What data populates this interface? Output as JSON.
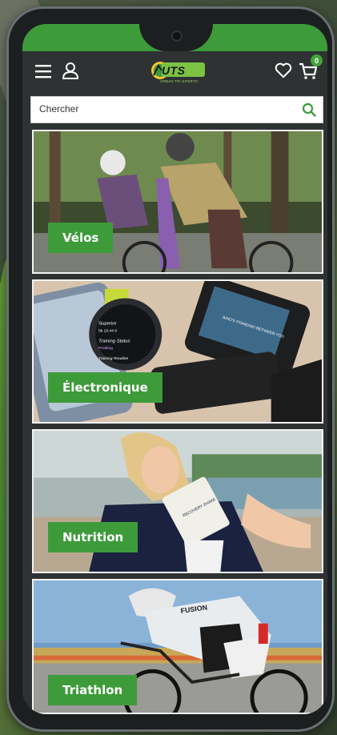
{
  "header": {
    "logo_text": "UTS",
    "logo_subtitle": "URBAN TRI SPORTS",
    "cart_count": "0"
  },
  "search": {
    "placeholder": "Chercher"
  },
  "categories": [
    {
      "label": "Vélos"
    },
    {
      "label": "Électronique"
    },
    {
      "label": "Nutrition"
    },
    {
      "label": "Triathlon"
    }
  ],
  "photo_text": {
    "watch_lines": [
      "Superior",
      "5k 15:44 0",
      "Training Status",
      "Peaking",
      "Training Readine"
    ],
    "gps_text": "WHO'S STANDING BETWEEN YOU",
    "pouch_text": "RECOVERY SHAKE",
    "jersey_text": "FUSION"
  },
  "colors": {
    "accent_green": "#3e9b3a",
    "header_bg": "#2f3233"
  },
  "icons": [
    "menu-icon",
    "user-icon",
    "heart-icon",
    "cart-icon",
    "search-icon"
  ]
}
